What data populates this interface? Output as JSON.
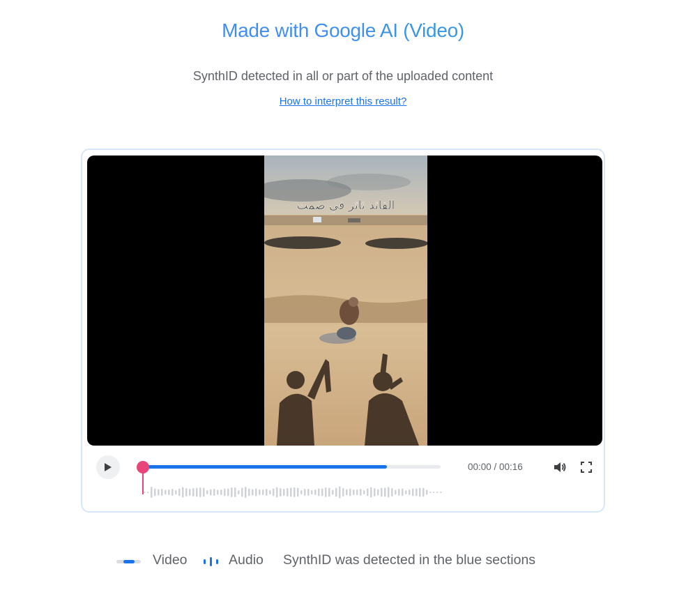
{
  "header": {
    "title": "Made with Google AI (Video)",
    "subtitle": "SynthID detected in all or part of the uploaded content",
    "help_link": "How to interpret this result?"
  },
  "player": {
    "frame_overlay_text": "القائد ثائر في صمت",
    "time_display": "00:00 / 00:16",
    "current_time": "00:00",
    "duration": "00:16",
    "video_progress": 0.82,
    "playhead_position": 0.0,
    "icons": {
      "play": "play-icon",
      "volume": "volume-icon",
      "fullscreen": "fullscreen-icon"
    }
  },
  "legend": {
    "video_label": "Video",
    "audio_label": "Audio",
    "note": "SynthID was detected in the blue sections"
  },
  "colors": {
    "accent_blue": "#1a73e8",
    "playhead_pink": "#e8467a",
    "track_gray": "#e8eaed",
    "card_border": "#d6e6fb"
  }
}
